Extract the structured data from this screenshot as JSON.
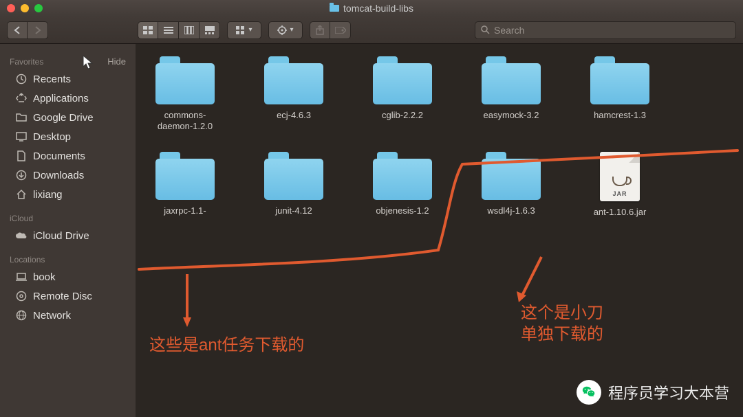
{
  "window": {
    "title": "tomcat-build-libs"
  },
  "toolbar": {
    "search_placeholder": "Search"
  },
  "sidebar": {
    "groups": [
      {
        "label": "Favorites",
        "hide_label": "Hide",
        "items": [
          {
            "icon": "clock-icon",
            "label": "Recents"
          },
          {
            "icon": "apps-icon",
            "label": "Applications"
          },
          {
            "icon": "google-drive-icon",
            "label": "Google Drive"
          },
          {
            "icon": "desktop-icon",
            "label": "Desktop"
          },
          {
            "icon": "documents-icon",
            "label": "Documents"
          },
          {
            "icon": "downloads-icon",
            "label": "Downloads"
          },
          {
            "icon": "home-icon",
            "label": "lixiang"
          }
        ]
      },
      {
        "label": "iCloud",
        "items": [
          {
            "icon": "cloud-icon",
            "label": "iCloud Drive"
          }
        ]
      },
      {
        "label": "Locations",
        "items": [
          {
            "icon": "laptop-icon",
            "label": "book"
          },
          {
            "icon": "disc-icon",
            "label": "Remote Disc"
          },
          {
            "icon": "globe-icon",
            "label": "Network"
          }
        ]
      }
    ]
  },
  "files": [
    {
      "type": "folder",
      "label": "commons-daemon-1.2.0"
    },
    {
      "type": "folder",
      "label": "ecj-4.6.3"
    },
    {
      "type": "folder",
      "label": "cglib-2.2.2"
    },
    {
      "type": "folder",
      "label": "easymock-3.2"
    },
    {
      "type": "folder",
      "label": "hamcrest-1.3"
    },
    {
      "type": "folder",
      "label": "jaxrpc-1.1-"
    },
    {
      "type": "folder",
      "label": "junit-4.12"
    },
    {
      "type": "folder",
      "label": "objenesis-1.2"
    },
    {
      "type": "folder",
      "label": "wsdl4j-1.6.3"
    },
    {
      "type": "jar",
      "label": "ant-1.10.6.jar",
      "jar_text": "JAR"
    }
  ],
  "annotations": {
    "left_text": "这些是ant任务下载的",
    "right_text_line1": "这个是小刀",
    "right_text_line2": "单独下载的"
  },
  "watermark": {
    "text": "程序员学习大本营"
  }
}
